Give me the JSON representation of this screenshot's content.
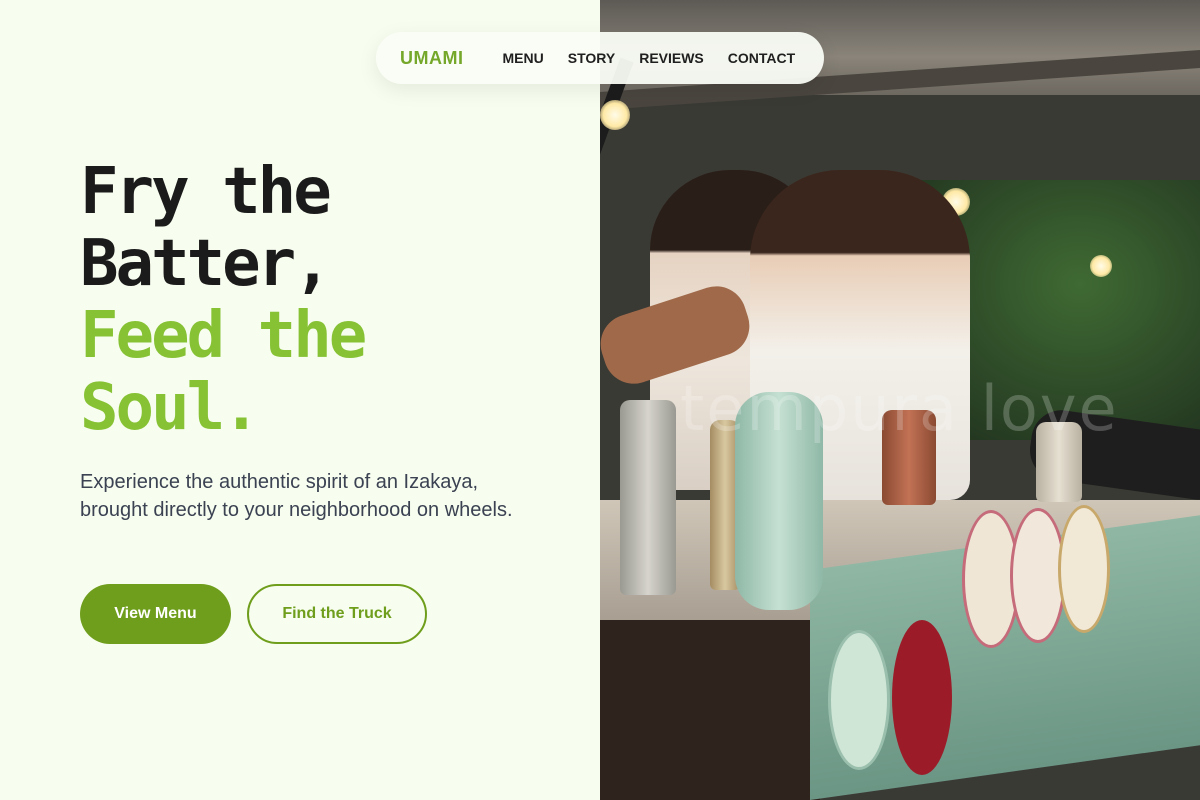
{
  "brand": "UMAMI",
  "nav": {
    "items": [
      {
        "label": "MENU"
      },
      {
        "label": "STORY"
      },
      {
        "label": "REVIEWS"
      },
      {
        "label": "CONTACT"
      }
    ]
  },
  "hero": {
    "headline": {
      "line1": "Fry the",
      "line2": "Batter,",
      "line3": "Feed the",
      "line4": "Soul."
    },
    "subtitle": "Experience the authentic spirit of an Izakaya, brought directly to your neighborhood on wheels.",
    "primary_button": "View Menu",
    "secondary_button": "Find the Truck"
  },
  "photo": {
    "watermark": "tempura love"
  },
  "colors": {
    "accent": "#6f9e1c",
    "accent_light": "#86c234",
    "background": "#f7fdef",
    "text_dark": "#1b1b1b",
    "text_body": "#3b4252"
  }
}
